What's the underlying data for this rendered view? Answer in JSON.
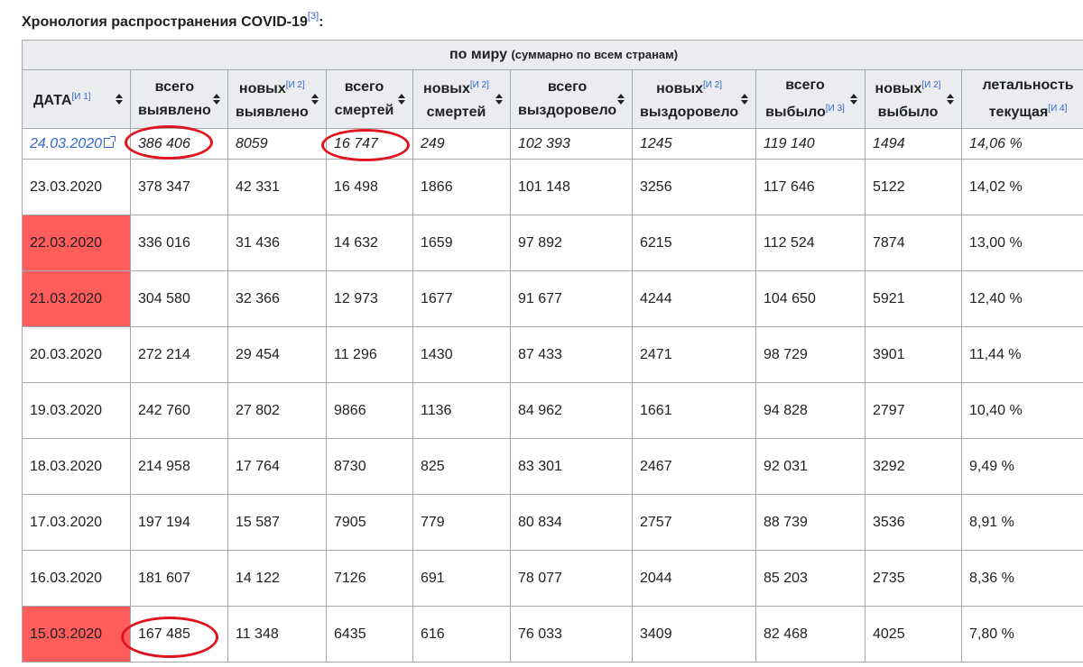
{
  "caption": {
    "text": "Хронология распространения COVID-19",
    "ref": "[3]",
    "suffix": ":"
  },
  "table": {
    "group_header": {
      "label": "по миру",
      "sub": "(суммарно по всем странам)"
    },
    "columns": [
      {
        "line1": "ДАТА",
        "ref": "[И 1]"
      },
      {
        "line1": "всего",
        "line2": "выявлено"
      },
      {
        "line1": "новых",
        "line1_ref": "[И 2]",
        "line2": "выявлено"
      },
      {
        "line1": "всего",
        "line2": "смертей"
      },
      {
        "line1": "новых",
        "line1_ref": "[И 2]",
        "line2": "смертей"
      },
      {
        "line1": "всего",
        "line2": "выздоровело"
      },
      {
        "line1": "новых",
        "line1_ref": "[И 2]",
        "line2": "выздоровело"
      },
      {
        "line1": "всего",
        "line2": "выбыло",
        "line2_ref": "[И 3]"
      },
      {
        "line1": "новых",
        "line1_ref": "[И 2]",
        "line2": "выбыло"
      },
      {
        "line1": "летальность",
        "line2": "текущая",
        "line2_ref": "[И 4]"
      }
    ],
    "rows": [
      {
        "date": "24.03.2020",
        "linked": true,
        "cells": [
          "386 406",
          "8059",
          "16 747",
          "249",
          "102 393",
          "1245",
          "119 140",
          "1494",
          "14,06 %"
        ]
      },
      {
        "date": "23.03.2020",
        "cells": [
          "378 347",
          "42 331",
          "16 498",
          "1866",
          "101 148",
          "3256",
          "117 646",
          "5122",
          "14,02 %"
        ]
      },
      {
        "date": "22.03.2020",
        "highlight": true,
        "cells": [
          "336 016",
          "31 436",
          "14 632",
          "1659",
          "97 892",
          "6215",
          "112 524",
          "7874",
          "13,00 %"
        ]
      },
      {
        "date": "21.03.2020",
        "highlight": true,
        "cells": [
          "304 580",
          "32 366",
          "12 973",
          "1677",
          "91 677",
          "4244",
          "104 650",
          "5921",
          "12,40 %"
        ]
      },
      {
        "date": "20.03.2020",
        "cells": [
          "272 214",
          "29 454",
          "11 296",
          "1430",
          "87 433",
          "2471",
          "98 729",
          "3901",
          "11,44 %"
        ]
      },
      {
        "date": "19.03.2020",
        "cells": [
          "242 760",
          "27 802",
          "9866",
          "1136",
          "84 962",
          "1661",
          "94 828",
          "2797",
          "10,40 %"
        ]
      },
      {
        "date": "18.03.2020",
        "cells": [
          "214 958",
          "17 764",
          "8730",
          "825",
          "83 301",
          "2467",
          "92 031",
          "3292",
          "9,49 %"
        ]
      },
      {
        "date": "17.03.2020",
        "cells": [
          "197 194",
          "15 587",
          "7905",
          "779",
          "80 834",
          "2757",
          "88 739",
          "3536",
          "8,91 %"
        ]
      },
      {
        "date": "16.03.2020",
        "cells": [
          "181 607",
          "14 122",
          "7126",
          "691",
          "78 077",
          "2044",
          "85 203",
          "2735",
          "8,36 %"
        ]
      },
      {
        "date": "15.03.2020",
        "highlight": true,
        "cells": [
          "167 485",
          "11 348",
          "6435",
          "616",
          "76 033",
          "3409",
          "82 468",
          "4025",
          "7,80 %"
        ]
      }
    ]
  },
  "colors": {
    "highlight": "#ff5c5c",
    "circle": "#e0141e",
    "header_bg": "#eaecf0",
    "link": "#3366cc"
  }
}
